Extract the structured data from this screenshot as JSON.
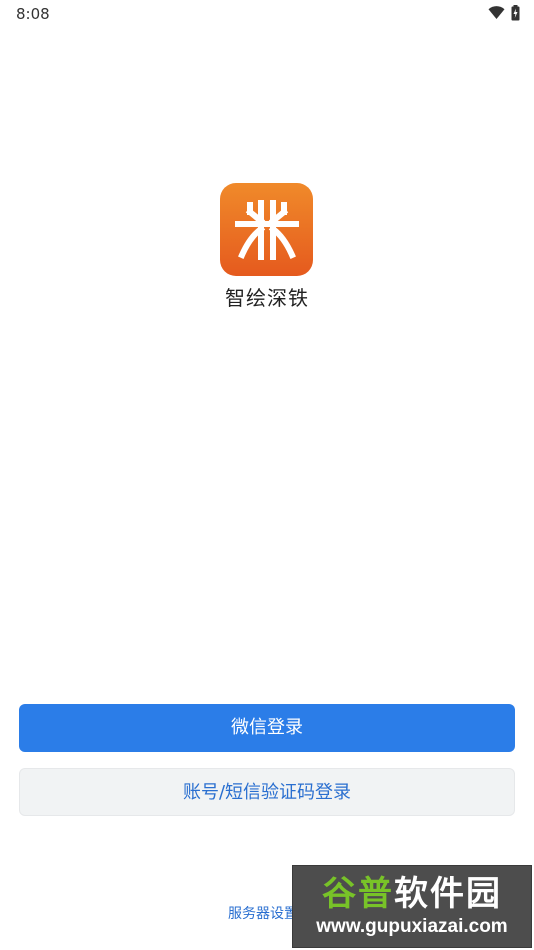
{
  "status_bar": {
    "time": "8:08",
    "icons": [
      "wifi-icon",
      "battery-charging-icon"
    ]
  },
  "app": {
    "name": "智绘深铁",
    "logo_icon": "shenzhen-metro-logo-icon",
    "logo_colors": [
      "#f08a2a",
      "#e55a1e"
    ]
  },
  "login": {
    "wechat_label": "微信登录",
    "account_label": "账号/短信验证码登录",
    "server_settings_label": "服务器设置"
  },
  "watermark": {
    "title_prefix": "谷普",
    "title_suffix": "软件园",
    "url": "www.gupuxiazai.com"
  },
  "colors": {
    "primary": "#2b7de8",
    "link": "#2a6fd0",
    "secondary_bg": "#f1f3f4"
  }
}
